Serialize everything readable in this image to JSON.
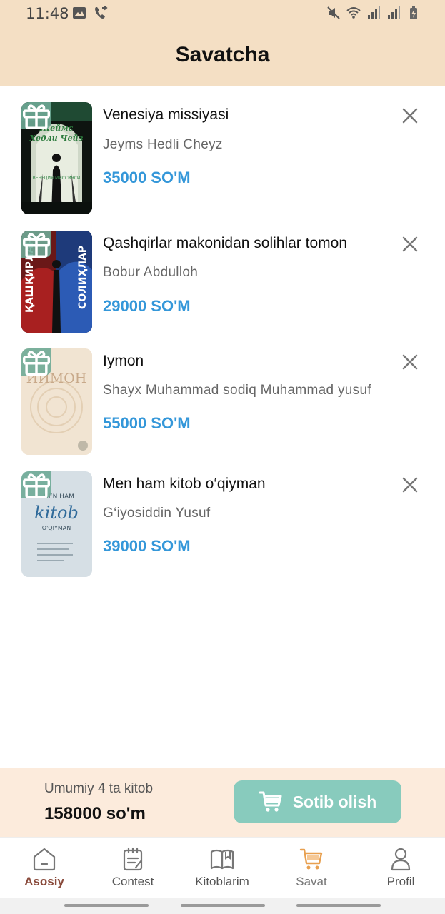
{
  "status_bar": {
    "time": "11:48"
  },
  "header": {
    "title": "Savatcha"
  },
  "cart": {
    "items": [
      {
        "title": "Venesiya missiyasi",
        "author": "Jeyms Hedli Cheyz",
        "price": "35000 SO'M"
      },
      {
        "title": "Qashqirlar makonidan solihlar tomon",
        "author": "Bobur Abdulloh",
        "price": "29000 SO'M"
      },
      {
        "title": "Iymon",
        "author": "Shayx Muhammad sodiq Muhammad yusuf",
        "price": "55000 SO'M"
      },
      {
        "title": "Men ham kitob o‘qiyman",
        "author": "G‘iyosiddin Yusuf",
        "price": "39000 SO'M"
      }
    ]
  },
  "checkout": {
    "summary": "Umumiy 4 ta kitob",
    "total": "158000 so'm",
    "buy_label": "Sotib olish"
  },
  "nav": {
    "home": "Asosiy",
    "contest": "Contest",
    "library": "Kitoblarim",
    "cart": "Savat",
    "profile": "Profil"
  },
  "covers": {
    "book1_line1": "Жеймс",
    "book1_line2": "Хедли Чейз",
    "book1_line3": "ВЕНЕЦИЯ МИССИЯСИ",
    "book2_left": "ҚАШҚИРЛАР",
    "book2_right": "СОЛИҲЛАР",
    "book3": "ИЙМОН",
    "book4_line1": "MEN HAM",
    "book4_line2": "kitob",
    "book4_line3": "O'QIYMAN"
  },
  "colors": {
    "header_bg": "#f4dfc4",
    "price": "#3497d9",
    "buy_button": "#88cbbd",
    "active_nav": "#8a4b3c",
    "cart_nav": "#e8a050"
  }
}
